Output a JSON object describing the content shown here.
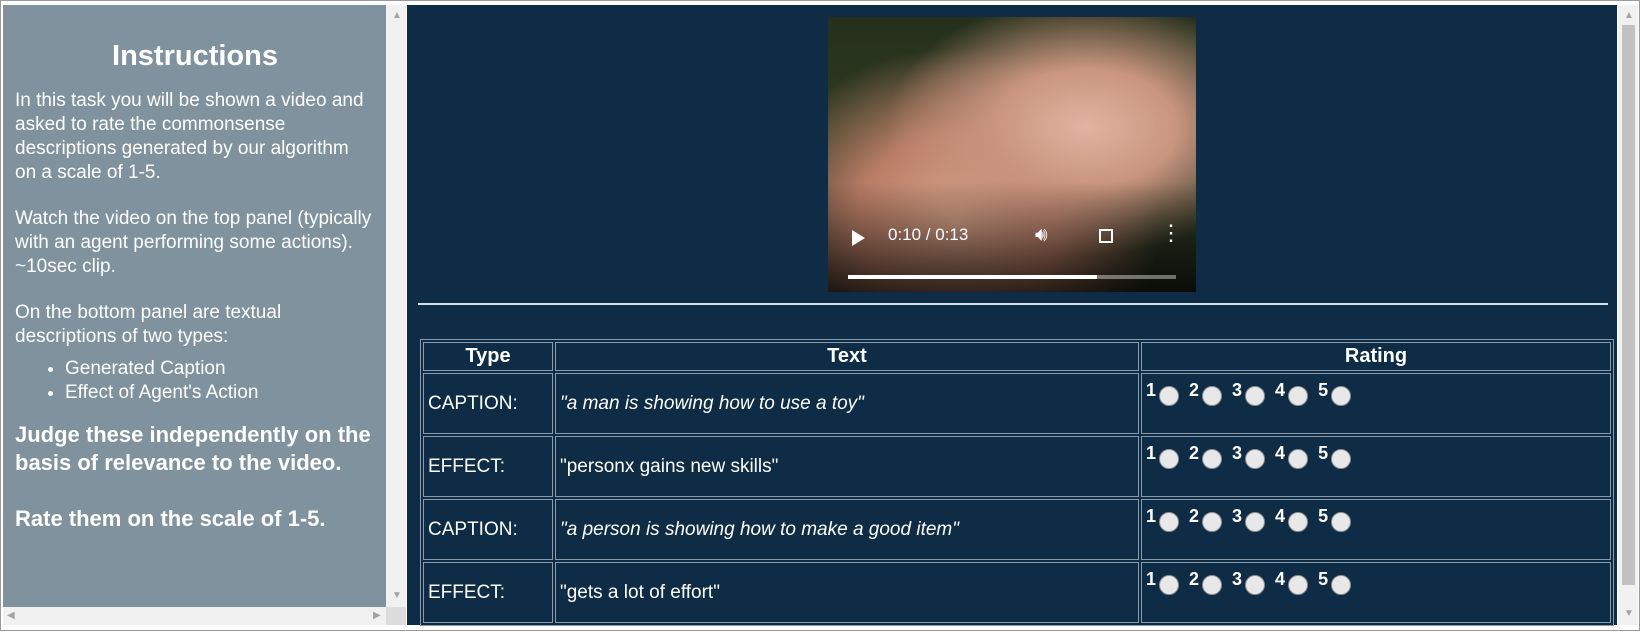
{
  "instructions": {
    "title": "Instructions",
    "para1": "In this task you will be shown a video and asked to rate the commonsense descriptions generated by our algorithm on a scale of 1-5.",
    "para2": "Watch the video on the top panel (typically with an agent performing some actions). ~10sec clip.",
    "para3": "On the bottom panel are textual descriptions of two types:",
    "types": [
      "Generated Caption",
      "Effect of Agent's Action"
    ],
    "emphasis1": "Judge these independently on the basis of relevance to the video.",
    "emphasis2": "Rate them on the scale of 1-5."
  },
  "video": {
    "time": "0:10 / 0:13",
    "progress": 0.76
  },
  "table": {
    "headers": {
      "type": "Type",
      "text": "Text",
      "rating": "Rating"
    },
    "rating_options": [
      "1",
      "2",
      "3",
      "4",
      "5"
    ],
    "rows": [
      {
        "type": "CAPTION:",
        "text": "\"a man is showing how to use a toy\""
      },
      {
        "type": "EFFECT:",
        "text": "\"personx gains new skills\""
      },
      {
        "type": "CAPTION:",
        "text": "\"a person is showing how to make a good item\""
      },
      {
        "type": "EFFECT:",
        "text": "\"gets a lot of effort\""
      }
    ]
  },
  "colors": {
    "left_panel": "#7f929e",
    "main_panel": "#0e2c45"
  }
}
